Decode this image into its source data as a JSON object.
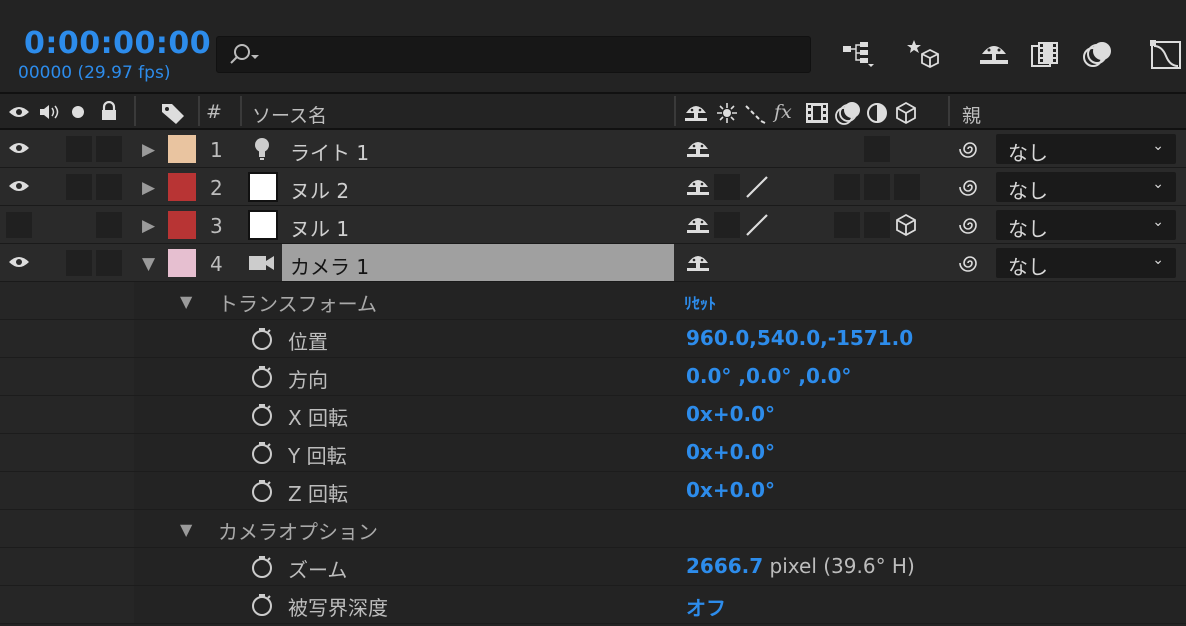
{
  "time": {
    "timecode": "0:00:00:00",
    "frames": "00000 (29.97 fps)"
  },
  "search": {
    "placeholder": ""
  },
  "header": {
    "hash": "#",
    "source_name": "ソース名",
    "fx": "fx",
    "parent": "親"
  },
  "layers": [
    {
      "num": "1",
      "name": "ライト 1",
      "label_color": "#e9c4a0",
      "parent": "なし",
      "twirl": "▶"
    },
    {
      "num": "2",
      "name": "ヌル 2",
      "label_color": "#b83434",
      "parent": "なし",
      "twirl": "▶"
    },
    {
      "num": "3",
      "name": "ヌル 1",
      "label_color": "#b83434",
      "parent": "なし",
      "twirl": "▶"
    },
    {
      "num": "4",
      "name": "カメラ 1",
      "label_color": "#e6bfd0",
      "parent": "なし",
      "twirl": "▼"
    }
  ],
  "transform": {
    "group": "トランスフォーム",
    "reset": "ﾘｾｯﾄ",
    "twirl": "▼",
    "properties": [
      {
        "name": "位置",
        "value": "960.0,540.0,-1571.0"
      },
      {
        "name": "方向",
        "value": "0.0° ,0.0° ,0.0°"
      },
      {
        "name": "X 回転",
        "value": "0x+0.0°"
      },
      {
        "name": "Y 回転",
        "value": "0x+0.0°"
      },
      {
        "name": "Z 回転",
        "value": "0x+0.0°"
      }
    ]
  },
  "camera_options": {
    "group": "カメラオプション",
    "twirl": "▼",
    "properties": [
      {
        "name": "ズーム",
        "value": "2666.7",
        "unit": " pixel (39.6° H)"
      },
      {
        "name": "被写界深度",
        "value": "オフ"
      }
    ]
  },
  "colors": {
    "accent": "#2d8ceb",
    "panel": "#232323",
    "selected": "#a0a0a0"
  }
}
